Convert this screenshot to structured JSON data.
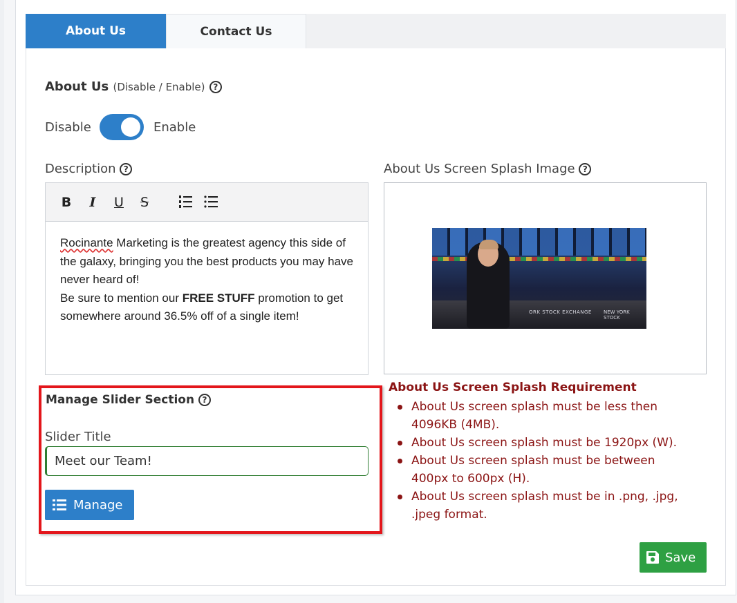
{
  "tabs": [
    {
      "label": "About Us",
      "active": true
    },
    {
      "label": "Contact Us",
      "active": false
    }
  ],
  "about_us": {
    "heading": "About Us",
    "heading_sub": "(Disable / Enable)",
    "toggle": {
      "off_label": "Disable",
      "on_label": "Enable",
      "state": "enabled"
    }
  },
  "description": {
    "label": "Description",
    "toolbar": [
      "bold",
      "italic",
      "underline",
      "strikethrough",
      "ordered-list",
      "unordered-list"
    ],
    "toolbar_glyphs": {
      "bold": "B",
      "italic": "I",
      "underline": "U",
      "strike": "S"
    },
    "content": {
      "spell_word": "Rocinante",
      "line1_rest": " Marketing is the greatest agency this side of the galaxy, bringing you the best products you may have never heard of!",
      "line2_before": "Be sure to mention our ",
      "line2_bold": "FREE STUFF",
      "line2_after": " promotion to get somewhere around 36.5% off of a single item!"
    }
  },
  "splash_image": {
    "label": "About Us Screen Splash Image",
    "photo_text_1": "ORK STOCK EXCHANGE",
    "photo_text_2": "NEW YORK STOCK"
  },
  "requirements": {
    "title": "About Us Screen Splash Requirement",
    "items": [
      "About Us screen splash must be less then 4096KB (4MB).",
      "About Us screen splash must be 1920px (W).",
      "About Us screen splash must be between 400px to 600px (H).",
      "About Us screen splash must be in .png, .jpg, .jpeg format."
    ]
  },
  "slider": {
    "heading": "Manage Slider Section",
    "title_label": "Slider Title",
    "title_value": "Meet our Team!",
    "manage_label": "Manage"
  },
  "actions": {
    "save_label": "Save"
  },
  "colors": {
    "primary": "#2d7fc9",
    "success": "#2ea043",
    "danger_text": "#8b1414",
    "highlight": "#e3161b"
  },
  "help_glyph": "?"
}
